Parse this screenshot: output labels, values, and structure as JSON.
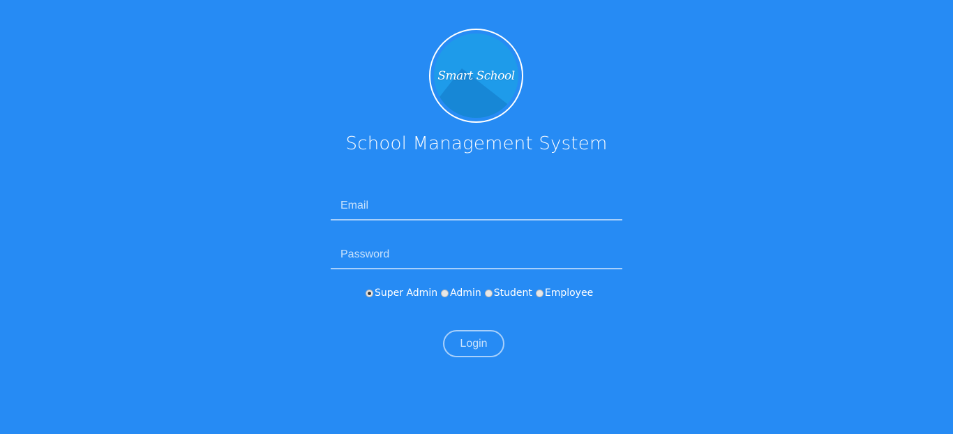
{
  "logo": {
    "text": "Smart School"
  },
  "title": "School Management System",
  "form": {
    "email_placeholder": "Email",
    "email_value": "",
    "password_placeholder": "Password",
    "password_value": "",
    "roles": [
      {
        "label": "Super Admin",
        "checked": true
      },
      {
        "label": "Admin",
        "checked": false
      },
      {
        "label": "Student",
        "checked": false
      },
      {
        "label": "Employee",
        "checked": false
      }
    ],
    "login_label": "Login"
  },
  "colors": {
    "background": "#268bf4",
    "logo_fill": "#1e9bea",
    "text": "#ffffff"
  }
}
